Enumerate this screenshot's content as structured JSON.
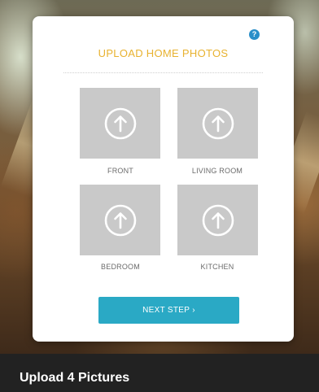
{
  "dialog": {
    "title": "UPLOAD HOME PHOTOS",
    "help_label": "?",
    "colors": {
      "title": "#e8b230",
      "help": "#2a8fc9",
      "button": "#2aa9c5",
      "tile": "#c9c9c9"
    }
  },
  "photo_slots": [
    {
      "label": "FRONT",
      "icon": "upload-arrow-icon"
    },
    {
      "label": "LIVING ROOM",
      "icon": "upload-arrow-icon"
    },
    {
      "label": "BEDROOM",
      "icon": "upload-arrow-icon"
    },
    {
      "label": "KITCHEN",
      "icon": "upload-arrow-icon"
    }
  ],
  "next_button": {
    "label": "NEXT STEP",
    "icon": "chevron-right-icon",
    "chevron": "›"
  },
  "caption": "Upload 4 Pictures"
}
